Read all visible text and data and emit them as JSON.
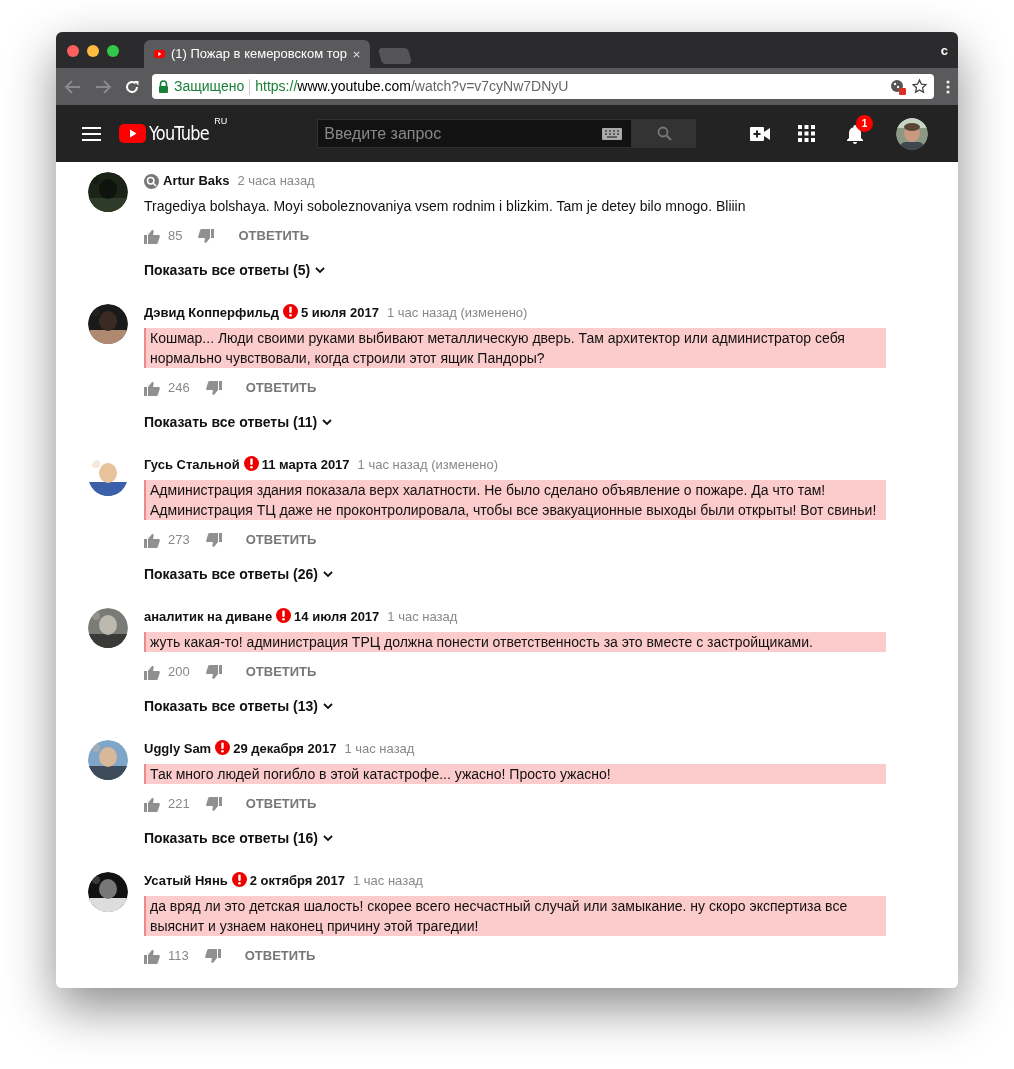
{
  "browser": {
    "tab": {
      "title": "(1) Пожар в кемеровском тор",
      "selected": true
    },
    "profile": "c",
    "address": {
      "secure_label": "Защищено",
      "scheme": "https://",
      "host": "www.youtube.com",
      "path": "/watch?v=v7cyNw7DNyU"
    }
  },
  "header": {
    "logo": "YouTube",
    "region": "RU",
    "search": {
      "placeholder": "Введите запрос"
    },
    "notifications": "1"
  },
  "comments": [
    {
      "kind": "plain",
      "author": "Artur Baks",
      "time": "2 часа назад",
      "text": "Tragediya bolshaya. Moyi soboleznovaniya vsem rodnim i blizkim. Tam je detey bilo mnogo. Bliiin",
      "likes": "85",
      "reply": "ОТВЕТИТЬ",
      "replies": "Показать все ответы (5)"
    },
    {
      "kind": "flagged",
      "author": "Дэвид Копперфильд",
      "date": "5 июля 2017",
      "time": "1 час назад (изменено)",
      "text": "Кошмар... Люди своими руками выбивают металлическую дверь. Там архитектор или администратор себя нормально чувствовали, когда строили этот ящик Пандоры?",
      "likes": "246",
      "reply": "ОТВЕТИТЬ",
      "replies": "Показать все ответы (11)"
    },
    {
      "kind": "flagged",
      "author": "Гусь Стальной",
      "date": "11 марта 2017",
      "time": "1 час назад (изменено)",
      "text": "Администрация здания показала верх халатности. Не было сделано объявление о пожаре. Да что там! Администрация ТЦ даже не проконтролировала, чтобы все эвакуационные выходы были открыты! Вот свиньи!",
      "likes": "273",
      "reply": "ОТВЕТИТЬ",
      "replies": "Показать все ответы (26)"
    },
    {
      "kind": "flagged",
      "author": "аналитик на диване",
      "date": "14 июля 2017",
      "time": "1 час назад",
      "text": "жуть какая-то! администрация ТРЦ должна понести ответственность за это вместе с застройщиками.",
      "likes": "200",
      "reply": "ОТВЕТИТЬ",
      "replies": "Показать все ответы (13)"
    },
    {
      "kind": "flagged",
      "author": "Uggly Sam",
      "date": "29 декабря 2017",
      "time": "1 час назад",
      "text": "Так много людей погибло в этой катастрофе... ужасно! Просто ужасно!",
      "likes": "221",
      "reply": "ОТВЕТИТЬ",
      "replies": "Показать все ответы (16)"
    },
    {
      "kind": "flagged",
      "author": "Усатый Нянь",
      "date": "2 октября 2017",
      "time": "1 час назад",
      "text": "да вряд ли это детская шалость! скорее всего несчастный случай или замыкание. ну скоро экспертиза все выяснит и узнаем наконец причину этой трагедии!",
      "likes": "113",
      "reply": "ОТВЕТИТЬ"
    }
  ]
}
